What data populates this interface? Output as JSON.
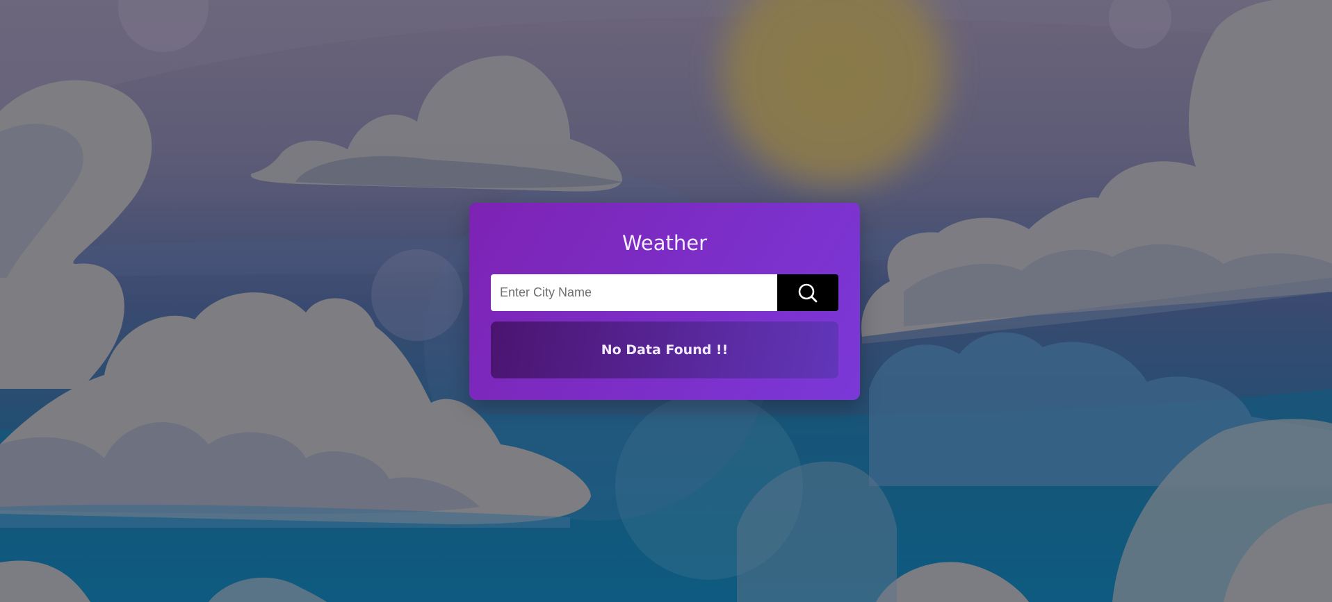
{
  "app": {
    "title": "Weather"
  },
  "search": {
    "placeholder": "Enter City Name",
    "value": "",
    "button_icon": "search-icon"
  },
  "result": {
    "message": "No Data Found !!"
  },
  "colors": {
    "card_gradient_start": "#7d23b4",
    "card_gradient_end": "#7b38d8",
    "result_gradient_start": "#4b1470",
    "result_gradient_end": "#6236ba",
    "search_button": "#000000"
  }
}
